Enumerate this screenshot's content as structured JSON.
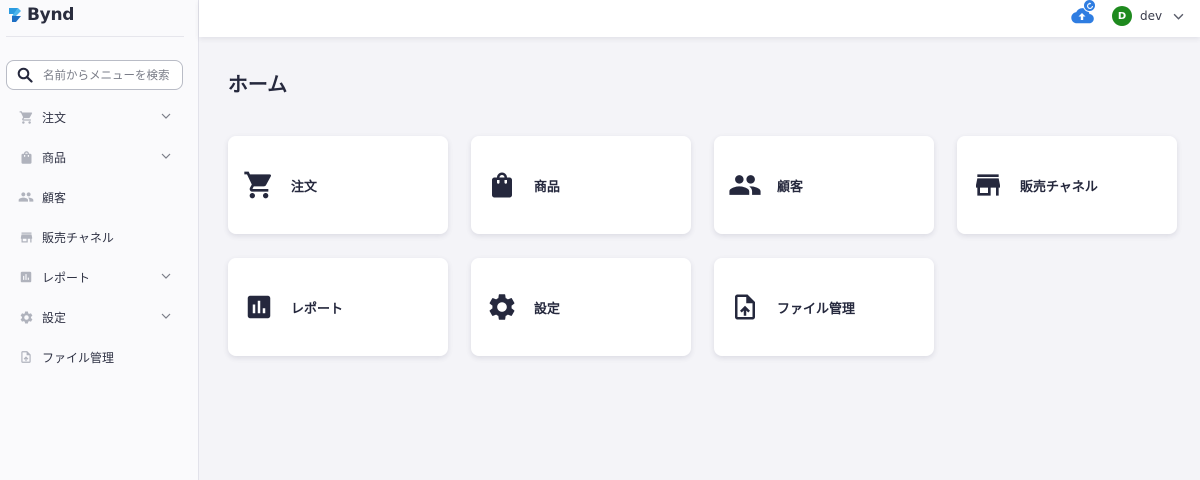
{
  "app": {
    "brand": "Bynd"
  },
  "search": {
    "placeholder": "名前からメニューを検索",
    "value": ""
  },
  "sidebar": {
    "items": [
      {
        "label": "注文",
        "icon": "cart-icon",
        "expandable": true
      },
      {
        "label": "商品",
        "icon": "bag-icon",
        "expandable": true
      },
      {
        "label": "顧客",
        "icon": "people-icon",
        "expandable": false
      },
      {
        "label": "販売チャネル",
        "icon": "store-icon",
        "expandable": false
      },
      {
        "label": "レポート",
        "icon": "chart-icon",
        "expandable": true
      },
      {
        "label": "設定",
        "icon": "gear-icon",
        "expandable": true
      },
      {
        "label": "ファイル管理",
        "icon": "file-icon",
        "expandable": false
      }
    ]
  },
  "header": {
    "user": {
      "initial": "D",
      "name": "dev"
    },
    "sync_badge_icon": "sync-icon",
    "cloud_icon": "cloud-upload-icon"
  },
  "main": {
    "title": "ホーム",
    "cards": [
      {
        "label": "注文",
        "icon": "cart-icon"
      },
      {
        "label": "商品",
        "icon": "bag-icon"
      },
      {
        "label": "顧客",
        "icon": "people-icon"
      },
      {
        "label": "販売チャネル",
        "icon": "store-icon"
      },
      {
        "label": "レポート",
        "icon": "chart-icon"
      },
      {
        "label": "設定",
        "icon": "gear-icon"
      },
      {
        "label": "ファイル管理",
        "icon": "file-icon"
      }
    ]
  },
  "colors": {
    "accent": "#2f7de1",
    "icon_dark": "#25283d",
    "icon_muted": "#b0b3bd",
    "avatar": "#1e8a1e",
    "background": "#f4f4f8"
  }
}
